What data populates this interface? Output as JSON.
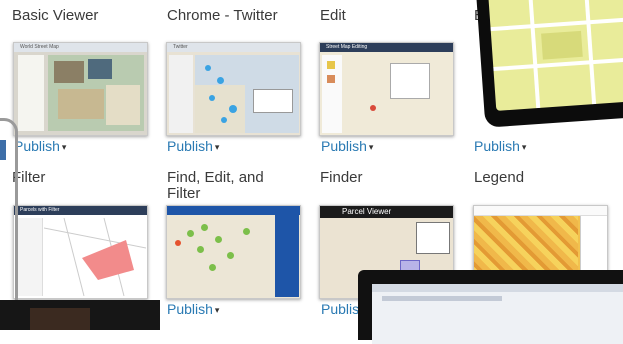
{
  "templates": [
    {
      "title": "Basic Viewer",
      "publish": "Publish"
    },
    {
      "title": "Chrome - Twitter",
      "publish": "Publish"
    },
    {
      "title": "Edit",
      "publish": "Publish"
    },
    {
      "title": "E",
      "publish": "Publish"
    },
    {
      "title": "Filter",
      "publish": ""
    },
    {
      "title": "Find, Edit, and Filter",
      "publish": "Publish"
    },
    {
      "title": "Finder",
      "publish": "Publis"
    },
    {
      "title": "Legend",
      "publish": ""
    }
  ],
  "publish_caret": "▾",
  "thumb_labels": {
    "basic_viewer": "World Street Map",
    "chrome_twitter": "Twitter",
    "edit": "Street Map Editing",
    "filter": "Parcels with Filter",
    "finder": "Parcel Viewer"
  },
  "colors": {
    "link": "#2a7ab3",
    "device_bezel": "#0c0c0c",
    "map_parcel": "#e9ec9a"
  }
}
